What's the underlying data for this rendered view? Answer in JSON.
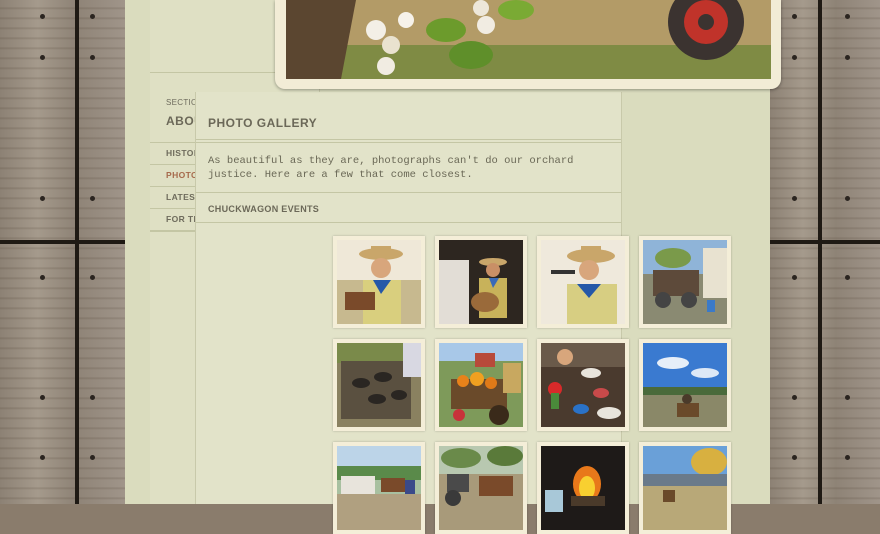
{
  "sidebar": {
    "section_label": "SECTION",
    "section_title": "ABOUT US",
    "items": [
      {
        "label": "HISTORY",
        "active": false
      },
      {
        "label": "PHOTO GALLERY",
        "active": true
      },
      {
        "label": "LATEST NEWS",
        "active": false
      },
      {
        "label": "FOR THE MEDIA",
        "active": false
      }
    ]
  },
  "main": {
    "title": "PHOTO GALLERY",
    "intro": "As beautiful as they are, photographs can't do our orchard justice. Here are a few that come closest.",
    "gallery_title": "CHUCKWAGON EVENTS"
  },
  "colors": {
    "page_bg": "#dadcbe",
    "active_nav": "#a66a4c",
    "text": "#6b6858"
  },
  "gallery": [
    {
      "name": "singer-cowboy-hat"
    },
    {
      "name": "guitarist-cowboy"
    },
    {
      "name": "singer-microphone"
    },
    {
      "name": "chuckwagon-camp"
    },
    {
      "name": "dutch-ovens-fire"
    },
    {
      "name": "pumpkin-wagon"
    },
    {
      "name": "serving-table"
    },
    {
      "name": "horse-rider-blue-sky"
    },
    {
      "name": "horse-wagon-row"
    },
    {
      "name": "horse-drawn-wagon"
    },
    {
      "name": "campfire-night"
    },
    {
      "name": "autumn-trees-field"
    }
  ]
}
